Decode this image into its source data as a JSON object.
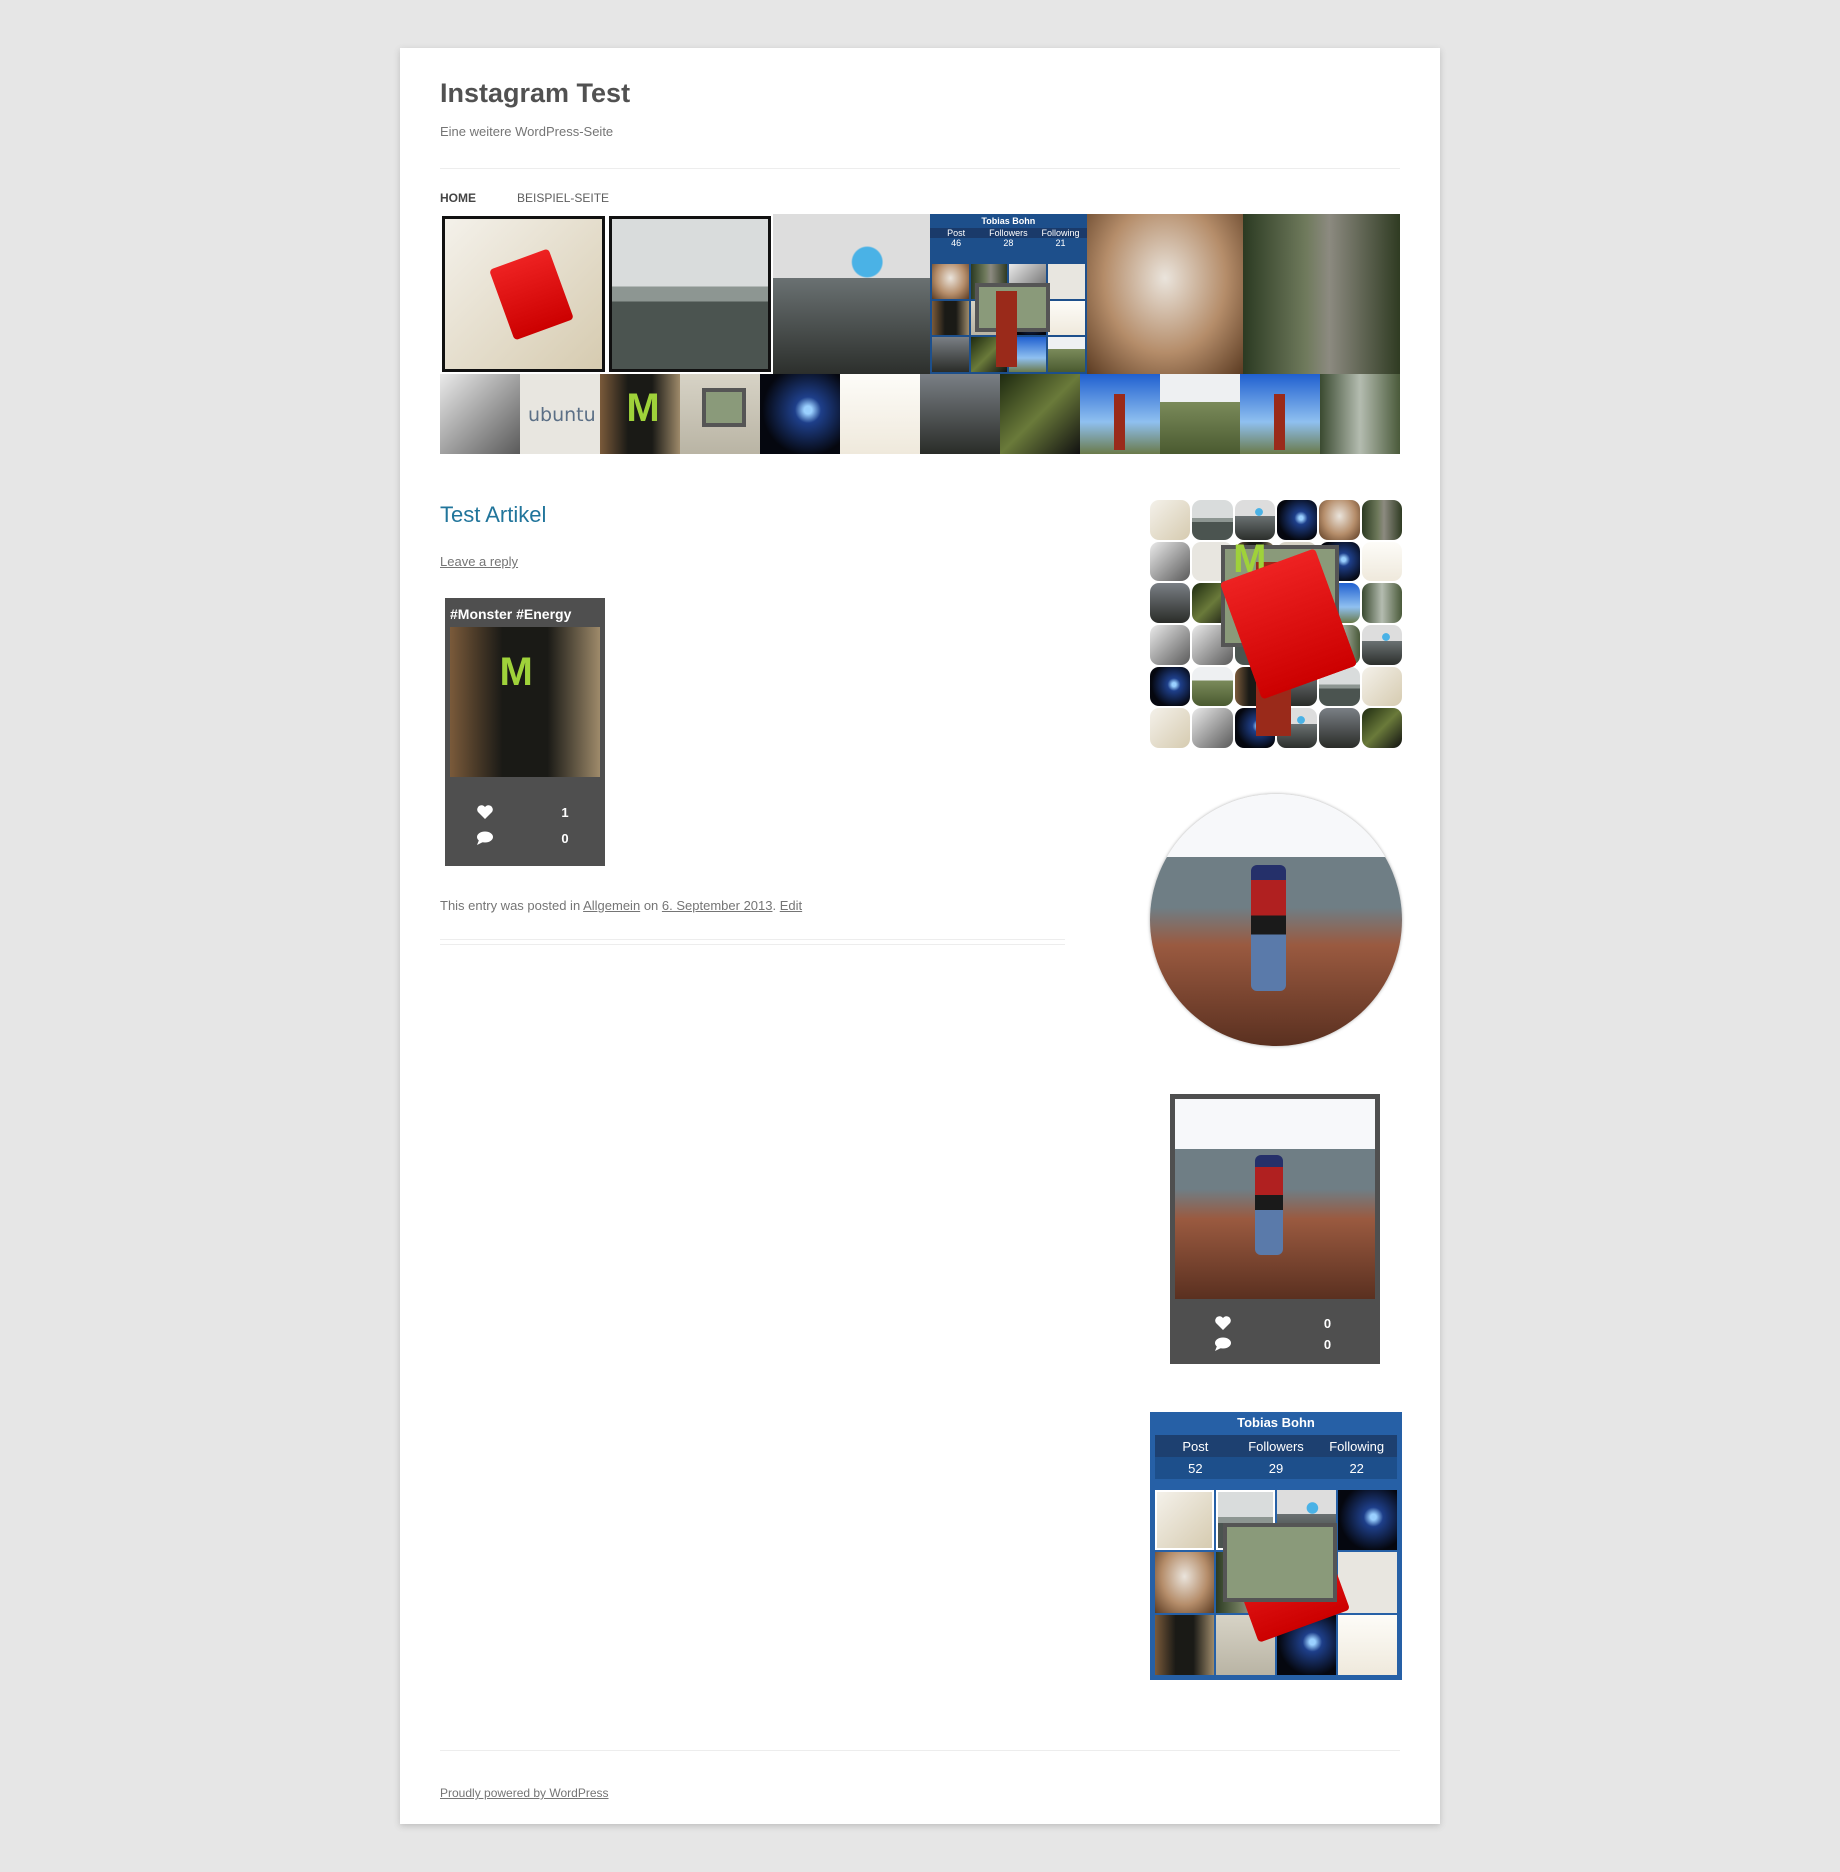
{
  "site": {
    "title": "Instagram Test",
    "tagline": "Eine weitere WordPress-Seite"
  },
  "nav": {
    "items": [
      {
        "label": "Home",
        "active": true
      },
      {
        "label": "Beispiel-Seite",
        "active": false
      }
    ]
  },
  "header_profile": {
    "name": "Tobias Bohn",
    "labels": [
      "Post",
      "Followers",
      "Following"
    ],
    "values": [
      "46",
      "28",
      "21"
    ]
  },
  "post": {
    "title": "Test Artikel",
    "leave_reply": "Leave a reply",
    "instagram": {
      "caption": "#Monster #Energy",
      "likes": "1",
      "comments": "0"
    },
    "meta": {
      "prefix": "This entry was posted in",
      "category": "Allgemein",
      "on": "on",
      "date": "6. September 2013",
      "edit": "Edit"
    }
  },
  "sidebar": {
    "photo_card": {
      "likes": "0",
      "comments": "0"
    },
    "profile": {
      "name": "Tobias Bohn",
      "labels": [
        "Post",
        "Followers",
        "Following"
      ],
      "values": [
        "52",
        "29",
        "22"
      ]
    }
  },
  "footer": {
    "credit": "Proudly powered by WordPress"
  },
  "colors": {
    "background": "#e6e6e6",
    "link": "#21759b",
    "card": "#4f4f4f",
    "profile_blue": "#2660a6"
  }
}
